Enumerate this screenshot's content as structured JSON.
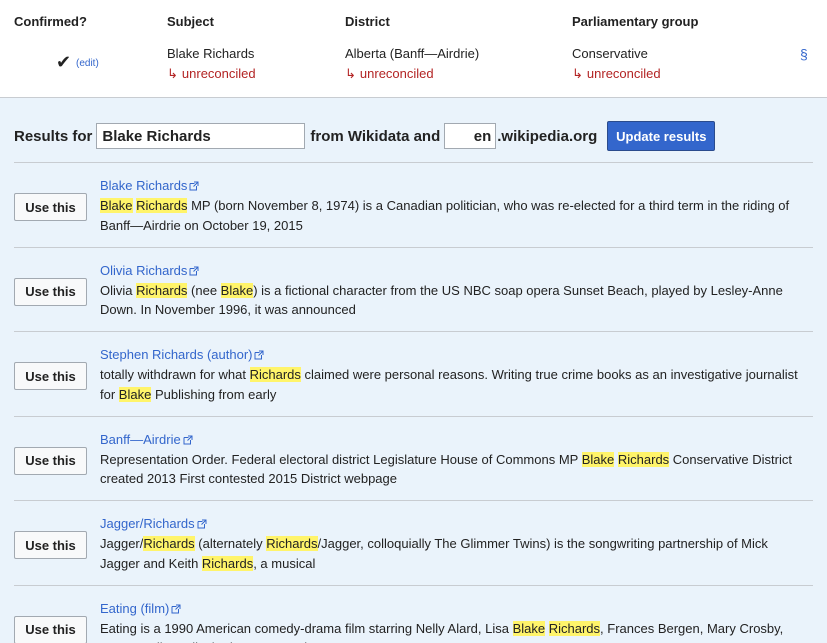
{
  "header": {
    "col_confirmed": "Confirmed?",
    "col_subject": "Subject",
    "col_district": "District",
    "col_group": "Parliamentary group",
    "check": "✔",
    "edit": "(edit)",
    "subject": "Blake Richards",
    "district": "Alberta (Banff—Airdrie)",
    "group": "Conservative",
    "unreconciled": "unreconciled",
    "arrow": "↳",
    "section": "§"
  },
  "search": {
    "results_for": "Results for",
    "query": "Blake Richards",
    "from_label": "from Wikidata and",
    "lang": "en",
    "domain": ".wikipedia.org",
    "update_label": "Update results"
  },
  "use_label": "Use this",
  "results": [
    {
      "title": "Blake Richards",
      "snippet": [
        {
          "t": "Blake",
          "h": true
        },
        {
          "t": " ",
          "h": false
        },
        {
          "t": "Richards",
          "h": true
        },
        {
          "t": " MP (born November 8, 1974) is a Canadian politician, who was re-elected for a third term in the riding of Banff—Airdrie on October 19, 2015",
          "h": false
        }
      ]
    },
    {
      "title": "Olivia Richards",
      "snippet": [
        {
          "t": "Olivia ",
          "h": false
        },
        {
          "t": "Richards",
          "h": true
        },
        {
          "t": " (nee ",
          "h": false
        },
        {
          "t": "Blake",
          "h": true
        },
        {
          "t": ") is a fictional character from the US NBC soap opera Sunset Beach, played by Lesley-Anne Down. In November 1996, it was announced",
          "h": false
        }
      ]
    },
    {
      "title": "Stephen Richards (author)",
      "snippet": [
        {
          "t": "totally withdrawn for what ",
          "h": false
        },
        {
          "t": "Richards",
          "h": true
        },
        {
          "t": " claimed were personal reasons. Writing true crime books as an investigative journalist for ",
          "h": false
        },
        {
          "t": "Blake",
          "h": true
        },
        {
          "t": " Publishing from early",
          "h": false
        }
      ]
    },
    {
      "title": "Banff—Airdrie",
      "snippet": [
        {
          "t": "Representation Order. Federal electoral district Legislature House of Commons MP ",
          "h": false
        },
        {
          "t": "Blake",
          "h": true
        },
        {
          "t": " ",
          "h": false
        },
        {
          "t": "Richards",
          "h": true
        },
        {
          "t": " Conservative District created 2013 First contested 2015 District webpage",
          "h": false
        }
      ]
    },
    {
      "title": "Jagger/Richards",
      "snippet": [
        {
          "t": "Jagger/",
          "h": false
        },
        {
          "t": "Richards",
          "h": true
        },
        {
          "t": " (alternately ",
          "h": false
        },
        {
          "t": "Richards",
          "h": true
        },
        {
          "t": "/Jagger, colloquially The Glimmer Twins) is the songwriting partnership of Mick Jagger and Keith ",
          "h": false
        },
        {
          "t": "Richards",
          "h": true
        },
        {
          "t": ", a musical",
          "h": false
        }
      ]
    },
    {
      "title": "Eating (film)",
      "snippet": [
        {
          "t": "Eating is a 1990 American comedy-drama film starring Nelly Alard, Lisa ",
          "h": false
        },
        {
          "t": "Blake",
          "h": true
        },
        {
          "t": " ",
          "h": false
        },
        {
          "t": "Richards",
          "h": true
        },
        {
          "t": ", Frances Bergen, Mary Crosby, Gwen Welles, Elizabeth Kemp, Marina Gregory",
          "h": false
        }
      ]
    }
  ],
  "colors": {
    "link": "#3366cc",
    "unreconciled": "#b32424",
    "panel_bg": "#eaf3fb",
    "highlight": "#fff46a",
    "primary_button": "#3366cc"
  }
}
